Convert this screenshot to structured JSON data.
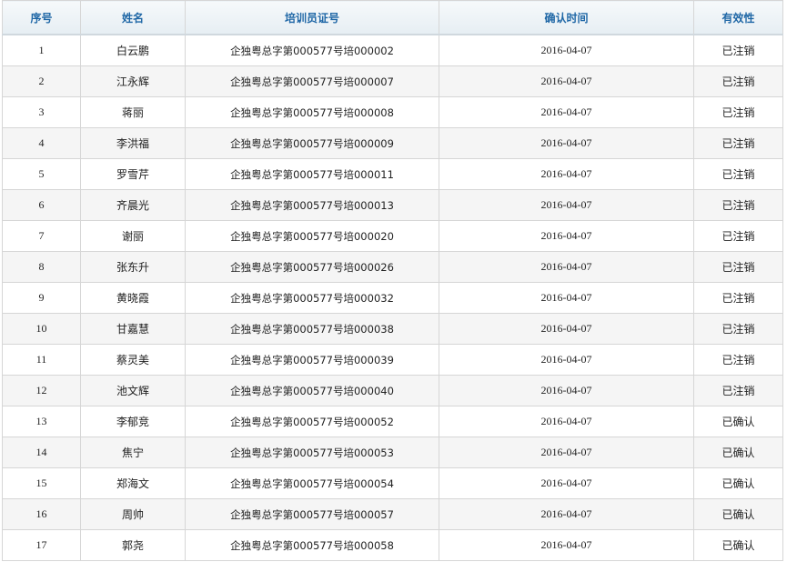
{
  "table": {
    "headers": {
      "index": "序号",
      "name": "姓名",
      "cert": "培训员证号",
      "confirm_time": "确认时间",
      "validity": "有效性"
    },
    "rows": [
      {
        "index": "1",
        "name": "白云鹏",
        "cert": "企独粤总字第000577号培000002",
        "confirm_time": "2016-04-07",
        "validity": "已注销"
      },
      {
        "index": "2",
        "name": "江永辉",
        "cert": "企独粤总字第000577号培000007",
        "confirm_time": "2016-04-07",
        "validity": "已注销"
      },
      {
        "index": "3",
        "name": "蒋丽",
        "cert": "企独粤总字第000577号培000008",
        "confirm_time": "2016-04-07",
        "validity": "已注销"
      },
      {
        "index": "4",
        "name": "李洪福",
        "cert": "企独粤总字第000577号培000009",
        "confirm_time": "2016-04-07",
        "validity": "已注销"
      },
      {
        "index": "5",
        "name": "罗雪芹",
        "cert": "企独粤总字第000577号培000011",
        "confirm_time": "2016-04-07",
        "validity": "已注销"
      },
      {
        "index": "6",
        "name": "齐晨光",
        "cert": "企独粤总字第000577号培000013",
        "confirm_time": "2016-04-07",
        "validity": "已注销"
      },
      {
        "index": "7",
        "name": "谢丽",
        "cert": "企独粤总字第000577号培000020",
        "confirm_time": "2016-04-07",
        "validity": "已注销"
      },
      {
        "index": "8",
        "name": "张东升",
        "cert": "企独粤总字第000577号培000026",
        "confirm_time": "2016-04-07",
        "validity": "已注销"
      },
      {
        "index": "9",
        "name": "黄晓霞",
        "cert": "企独粤总字第000577号培000032",
        "confirm_time": "2016-04-07",
        "validity": "已注销"
      },
      {
        "index": "10",
        "name": "甘嘉慧",
        "cert": "企独粤总字第000577号培000038",
        "confirm_time": "2016-04-07",
        "validity": "已注销"
      },
      {
        "index": "11",
        "name": "蔡灵美",
        "cert": "企独粤总字第000577号培000039",
        "confirm_time": "2016-04-07",
        "validity": "已注销"
      },
      {
        "index": "12",
        "name": "池文辉",
        "cert": "企独粤总字第000577号培000040",
        "confirm_time": "2016-04-07",
        "validity": "已注销"
      },
      {
        "index": "13",
        "name": "李郁竞",
        "cert": "企独粤总字第000577号培000052",
        "confirm_time": "2016-04-07",
        "validity": "已确认"
      },
      {
        "index": "14",
        "name": "焦宁",
        "cert": "企独粤总字第000577号培000053",
        "confirm_time": "2016-04-07",
        "validity": "已确认"
      },
      {
        "index": "15",
        "name": "郑海文",
        "cert": "企独粤总字第000577号培000054",
        "confirm_time": "2016-04-07",
        "validity": "已确认"
      },
      {
        "index": "16",
        "name": "周帅",
        "cert": "企独粤总字第000577号培000057",
        "confirm_time": "2016-04-07",
        "validity": "已确认"
      },
      {
        "index": "17",
        "name": "郭尧",
        "cert": "企独粤总字第000577号培000058",
        "confirm_time": "2016-04-07",
        "validity": "已确认"
      }
    ]
  },
  "colors": {
    "header_text": "#1f67a6",
    "border": "#d6d6d6",
    "stripe": "#f5f5f5"
  }
}
